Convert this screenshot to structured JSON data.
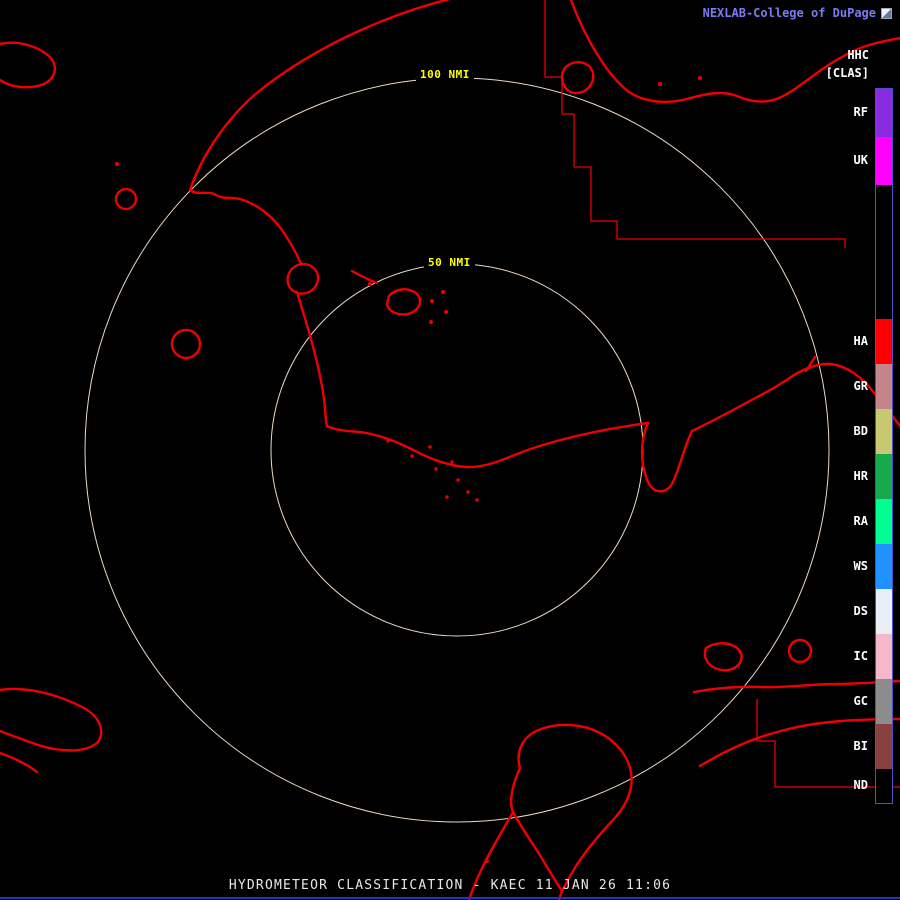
{
  "header": {
    "brand": "NEXLAB-College of DuPage",
    "brand_color": "#7b7bf2",
    "product_label": "HHC",
    "mode_label": "[CLAS]"
  },
  "rings": {
    "outer_label": "100 NMI",
    "inner_label": "50 NMI",
    "label_color": "#ffff00",
    "ring_color": "#efd9c4"
  },
  "map": {
    "outline_color": "#ee0000"
  },
  "legend": {
    "border_color": "#5050c8",
    "items": [
      {
        "label": "RF",
        "color": "#8a2be2"
      },
      {
        "label": "UK",
        "color": "#ff00ff"
      },
      {
        "label": "",
        "color": "#000000"
      },
      {
        "label": "HA",
        "color": "#ff0000"
      },
      {
        "label": "GR",
        "color": "#c4848c"
      },
      {
        "label": "BD",
        "color": "#c8c870"
      },
      {
        "label": "HR",
        "color": "#17a94c"
      },
      {
        "label": "RA",
        "color": "#00ff90"
      },
      {
        "label": "WS",
        "color": "#1e90ff"
      },
      {
        "label": "DS",
        "color": "#e8eef6"
      },
      {
        "label": "IC",
        "color": "#f5b8c8"
      },
      {
        "label": "GC",
        "color": "#8c8c8c"
      },
      {
        "label": "BI",
        "color": "#8b4040"
      },
      {
        "label": "ND",
        "color": "#000000"
      }
    ]
  },
  "statusbar": {
    "text": "HYDROMETEOR CLASSIFICATION - KAEC 11 JAN 26 11:06",
    "line_color": "#2233cc"
  }
}
